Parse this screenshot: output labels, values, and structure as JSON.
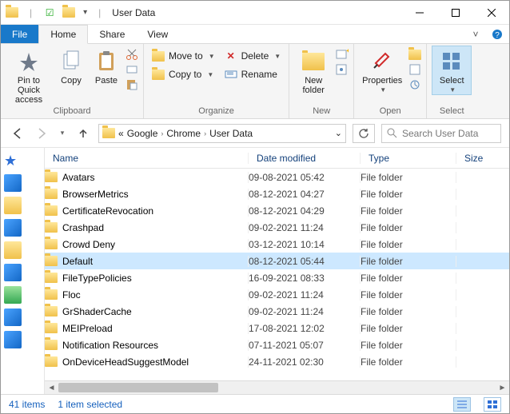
{
  "window": {
    "title": "User Data"
  },
  "tabs": {
    "file": "File",
    "home": "Home",
    "share": "Share",
    "view": "View"
  },
  "ribbon": {
    "clipboard": {
      "label": "Clipboard",
      "pin": "Pin to Quick access",
      "copy": "Copy",
      "paste": "Paste"
    },
    "organize": {
      "label": "Organize",
      "moveto": "Move to",
      "copyto": "Copy to",
      "delete": "Delete",
      "rename": "Rename"
    },
    "new": {
      "label": "New",
      "newfolder": "New folder"
    },
    "open": {
      "label": "Open",
      "properties": "Properties"
    },
    "select": {
      "label": "Select",
      "select": "Select"
    }
  },
  "breadcrumb": {
    "items": [
      "Google",
      "Chrome",
      "User Data"
    ]
  },
  "search": {
    "placeholder": "Search User Data"
  },
  "columns": {
    "name": "Name",
    "date": "Date modified",
    "type": "Type",
    "size": "Size"
  },
  "selected_index": 5,
  "items": [
    {
      "name": "Avatars",
      "date": "09-08-2021 05:42",
      "type": "File folder"
    },
    {
      "name": "BrowserMetrics",
      "date": "08-12-2021 04:27",
      "type": "File folder"
    },
    {
      "name": "CertificateRevocation",
      "date": "08-12-2021 04:29",
      "type": "File folder"
    },
    {
      "name": "Crashpad",
      "date": "09-02-2021 11:24",
      "type": "File folder"
    },
    {
      "name": "Crowd Deny",
      "date": "03-12-2021 10:14",
      "type": "File folder"
    },
    {
      "name": "Default",
      "date": "08-12-2021 05:44",
      "type": "File folder"
    },
    {
      "name": "FileTypePolicies",
      "date": "16-09-2021 08:33",
      "type": "File folder"
    },
    {
      "name": "Floc",
      "date": "09-02-2021 11:24",
      "type": "File folder"
    },
    {
      "name": "GrShaderCache",
      "date": "09-02-2021 11:24",
      "type": "File folder"
    },
    {
      "name": "MEIPreload",
      "date": "17-08-2021 12:02",
      "type": "File folder"
    },
    {
      "name": "Notification Resources",
      "date": "07-11-2021 05:07",
      "type": "File folder"
    },
    {
      "name": "OnDeviceHeadSuggestModel",
      "date": "24-11-2021 02:30",
      "type": "File folder"
    }
  ],
  "status": {
    "count": "41 items",
    "selected": "1 item selected"
  }
}
